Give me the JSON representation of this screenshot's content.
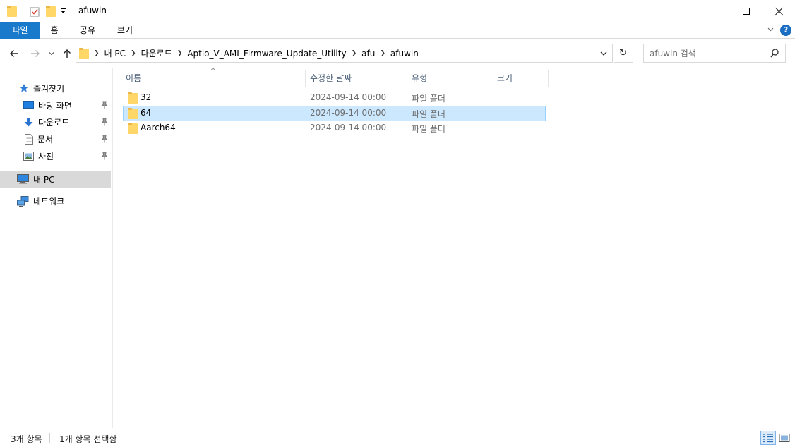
{
  "window": {
    "title": "afuwin"
  },
  "ribbon": {
    "tabs": [
      {
        "label": "파일"
      },
      {
        "label": "홈"
      },
      {
        "label": "공유"
      },
      {
        "label": "보기"
      }
    ],
    "help_label": "?"
  },
  "address": {
    "breadcrumbs": [
      "내 PC",
      "다운로드",
      "Aptio_V_AMI_Firmware_Update_Utility",
      "afu",
      "afuwin"
    ],
    "refresh_glyph": "↻"
  },
  "search": {
    "placeholder": "afuwin 검색"
  },
  "nav_pane": {
    "quick_access": "즐겨찾기",
    "quick_items": [
      {
        "label": "바탕 화면"
      },
      {
        "label": "다운로드"
      },
      {
        "label": "문서"
      },
      {
        "label": "사진"
      }
    ],
    "this_pc": "내 PC",
    "network": "네트워크"
  },
  "columns": {
    "name": "이름",
    "date": "수정한 날짜",
    "type": "유형",
    "size": "크기",
    "sort_caret": "^"
  },
  "files": [
    {
      "name": "32",
      "date": "2024-09-14 00:00",
      "type": "파일 폴더",
      "selected": false
    },
    {
      "name": "64",
      "date": "2024-09-14 00:00",
      "type": "파일 폴더",
      "selected": true
    },
    {
      "name": "Aarch64",
      "date": "2024-09-14 00:00",
      "type": "파일 폴더",
      "selected": false
    }
  ],
  "status": {
    "item_count": "3개 항목",
    "selected_count": "1개 항목 선택함"
  },
  "colors": {
    "accent": "#1979ca",
    "selection_bg": "#cce8ff",
    "selection_border": "#99d1ff",
    "folder": "#ffd768"
  }
}
